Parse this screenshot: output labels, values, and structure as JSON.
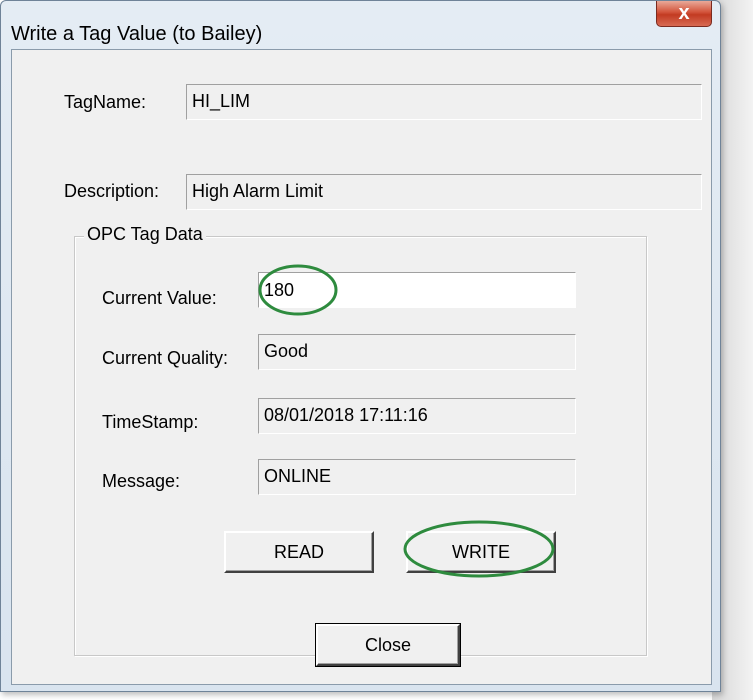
{
  "window": {
    "title": "Write a Tag Value (to Bailey)",
    "close_glyph": "x",
    "close_icon": "close-icon"
  },
  "tag": {
    "tagname_label": "TagName:",
    "tagname_value": "HI_LIM",
    "description_label": "Description:",
    "description_value": "High Alarm Limit"
  },
  "opc_group": {
    "label": "OPC Tag Data",
    "current_value_label": "Current Value:",
    "current_value": "180",
    "current_quality_label": "Current Quality:",
    "current_quality": "Good",
    "timestamp_label": "TimeStamp:",
    "timestamp": "08/01/2018 17:11:16",
    "message_label": "Message:",
    "message": "ONLINE"
  },
  "buttons": {
    "read": "READ",
    "write": "WRITE",
    "close": "Close"
  },
  "colors": {
    "highlight_ellipse": "#2e8b3e",
    "close_button": "#c9432b",
    "dialog_bg": "#f0f0f0"
  }
}
